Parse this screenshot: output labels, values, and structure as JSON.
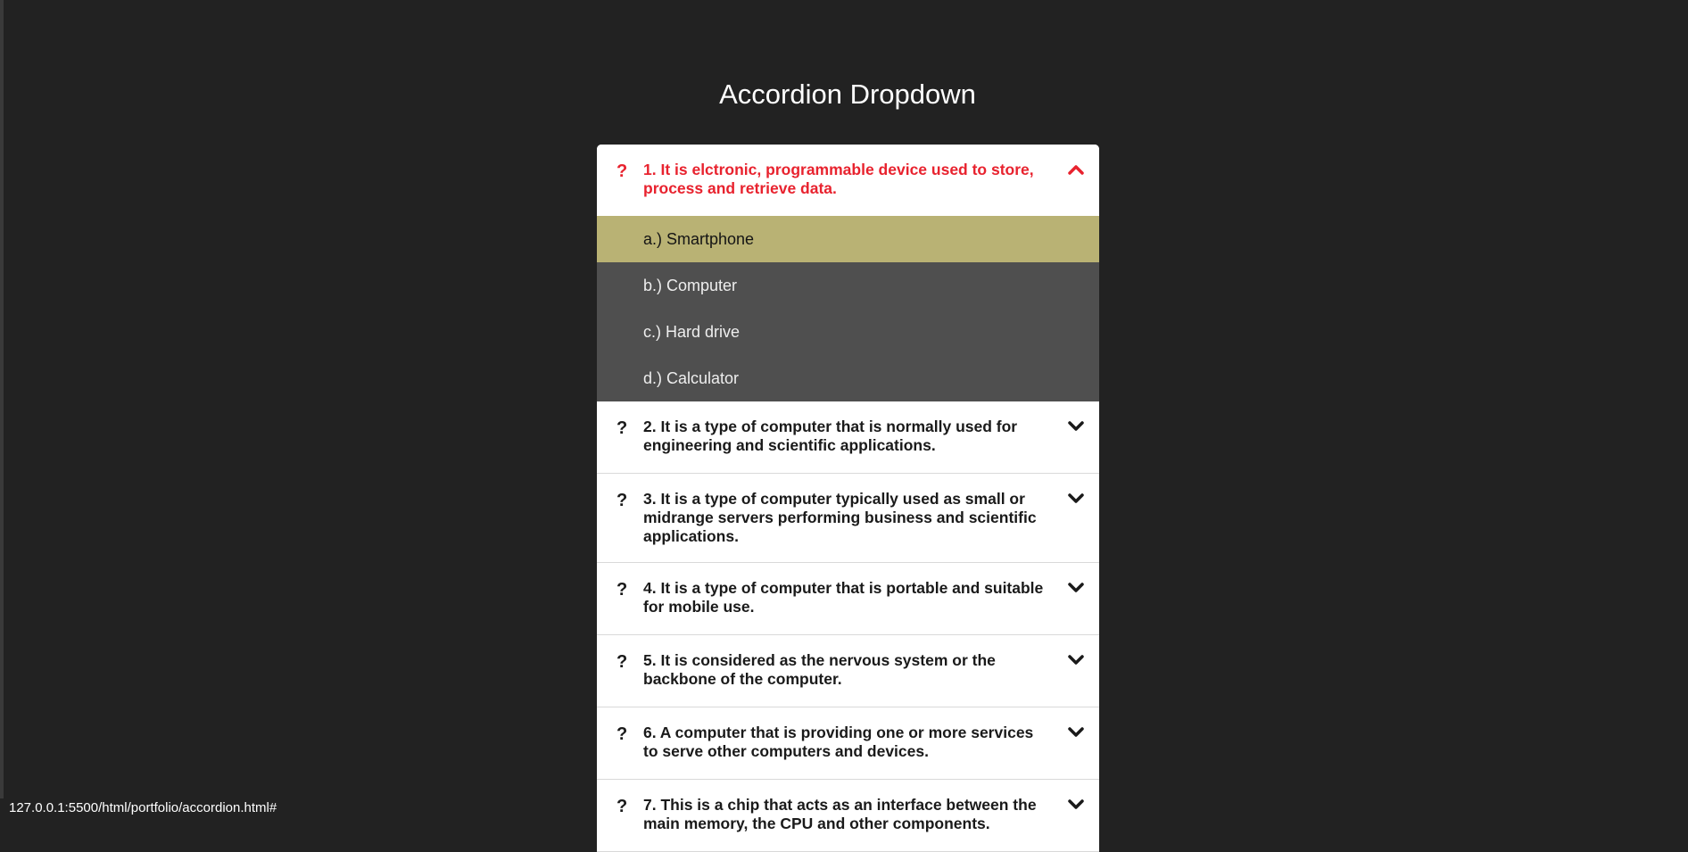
{
  "page": {
    "title": "Accordion Dropdown"
  },
  "accordion": {
    "active": {
      "question_mark": "?",
      "text": "1. It is elctronic, programmable device used to store, process and retrieve data.",
      "answers": [
        "a.) Smartphone",
        "b.) Computer",
        "c.) Hard drive",
        "d.) Calculator"
      ]
    },
    "items": [
      {
        "question_mark": "?",
        "text": "2. It is a type of computer that is normally used for engineering and scientific applications."
      },
      {
        "question_mark": "?",
        "text": "3. It is a type of computer typically used as small or midrange servers performing business and scientific applications."
      },
      {
        "question_mark": "?",
        "text": "4. It is a type of computer that is portable and suitable for mobile use."
      },
      {
        "question_mark": "?",
        "text": "5. It is considered as the nervous system or the backbone of the computer."
      },
      {
        "question_mark": "?",
        "text": "6. A computer that is providing one or more services to serve other computers and devices."
      },
      {
        "question_mark": "?",
        "text": "7. This is a chip that acts as an interface between the main memory, the CPU and other components."
      }
    ]
  },
  "icons": {
    "expanded": "chevron-up-icon",
    "collapsed": "chevron-down-icon"
  },
  "colors": {
    "background": "#222222",
    "active_question": "#e8222e",
    "selected_answer": "#b9b274",
    "answer_background": "#4f4f4f"
  },
  "status_bar": {
    "url": "127.0.0.1:5500/html/portfolio/accordion.html#"
  }
}
